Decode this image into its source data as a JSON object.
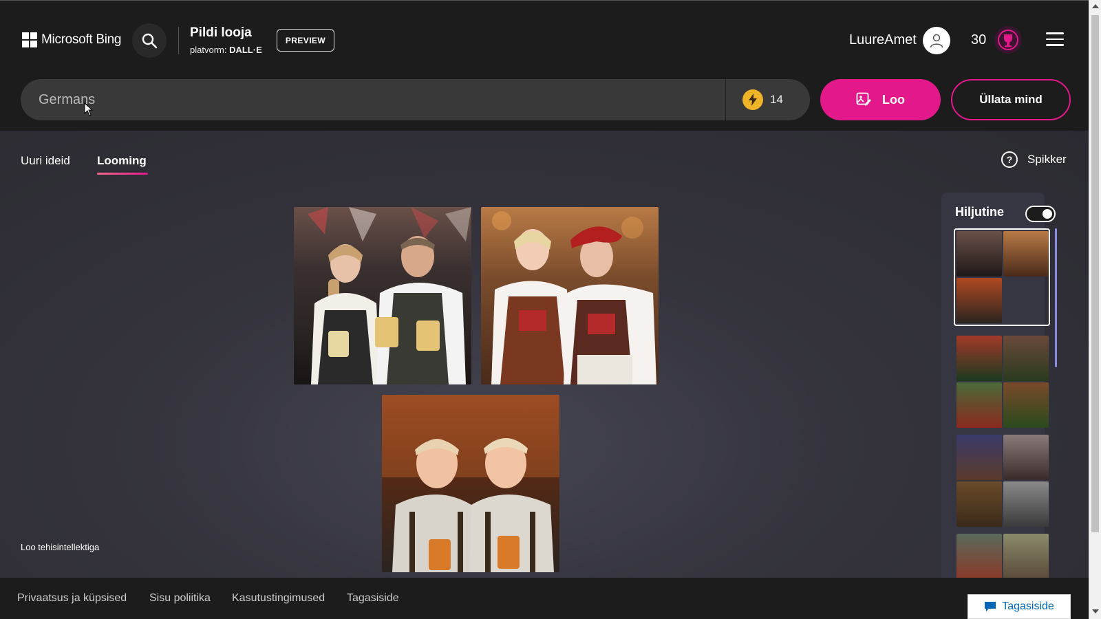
{
  "header": {
    "brand": "Microsoft Bing",
    "title": "Pildi looja",
    "platform_label": "platvorm: ",
    "platform_name": "DALL·E",
    "preview_label": "PREVIEW",
    "username": "LuureAmet",
    "points": "30"
  },
  "prompt": {
    "value": "Germans",
    "boosts": "14",
    "create_label": "Loo",
    "surprise_label": "Üllata mind"
  },
  "tabs": [
    {
      "label": "Uuri ideid",
      "active": false
    },
    {
      "label": "Looming",
      "active": true
    }
  ],
  "help_label": "Spikker",
  "caption": "Loo tehisintellektiga",
  "recent": {
    "title": "Hiljutine",
    "toggle_on": true
  },
  "footer": {
    "links": [
      "Privaatsus ja küpsised",
      "Sisu poliitika",
      "Kasutustingimused",
      "Tagasiside"
    ],
    "feedback_button": "Tagasiside"
  },
  "colors": {
    "accent": "#e3188b",
    "header_bg": "#1d1c1c",
    "boost_coin": "#f0b429"
  }
}
